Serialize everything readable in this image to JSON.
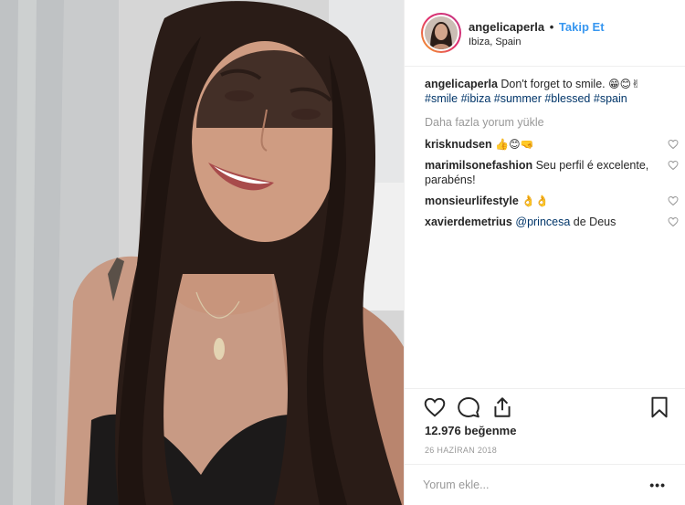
{
  "post": {
    "username": "angelicaperla",
    "separator": "•",
    "follow_label": "Takip Et",
    "location": "Ibiza, Spain",
    "caption": {
      "username": "angelicaperla",
      "text": "Don't forget to smile.",
      "emojis": "😁😊✌",
      "hashtags": [
        "#smile",
        "#ibiza",
        "#summer",
        "#blessed",
        "#spain"
      ]
    },
    "load_more_label": "Daha fazla yorum yükle",
    "comments": [
      {
        "username": "krisknudsen",
        "text": "",
        "emojis": "👍😊🤜"
      },
      {
        "username": "marimilsonefashion",
        "text": "Seu perfil é excelente, parabéns!",
        "emojis": ""
      },
      {
        "username": "monsieurlifestyle",
        "text": "",
        "emojis": "👌👌"
      },
      {
        "username": "xavierdemetrius",
        "mention": "@princesa",
        "text": "de Deus",
        "emojis": ""
      }
    ],
    "likes_label": "12.976 beğenme",
    "date_label": "26 HAZİRAN 2018",
    "comment_placeholder": "Yorum ekle...",
    "more_label": "•••"
  },
  "icons": {
    "like": "heart-icon",
    "comment": "comment-icon",
    "share": "share-icon",
    "save": "bookmark-icon",
    "comment_like": "small-heart-icon"
  },
  "colors": {
    "link_blue": "#3897f0",
    "hashtag": "#003569",
    "muted": "#999999",
    "text": "#262626"
  }
}
